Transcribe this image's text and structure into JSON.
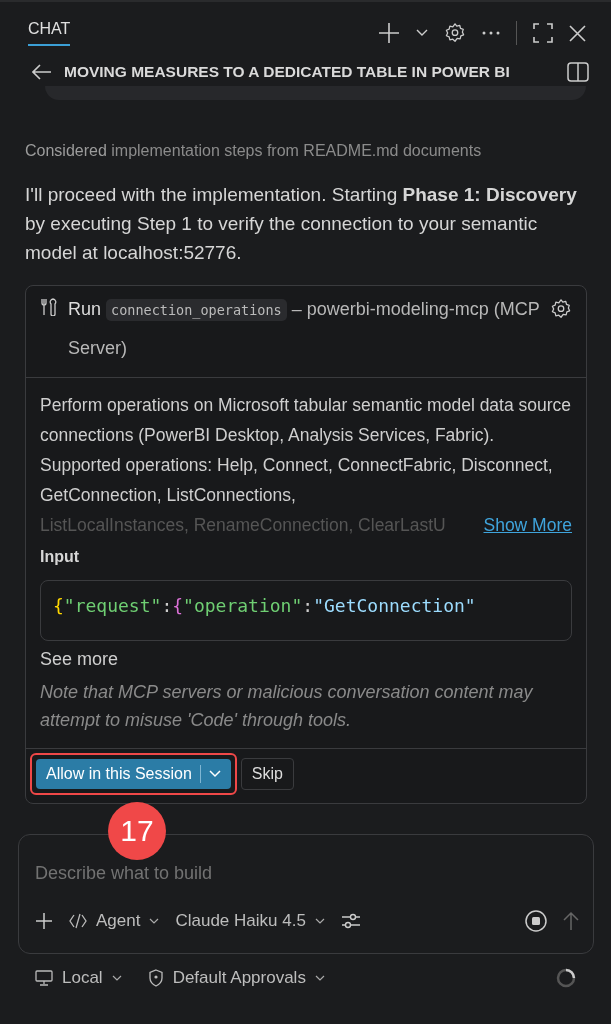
{
  "header": {
    "tab": "CHAT",
    "tab_selected": true
  },
  "title_bar": {
    "title": "MOVING MEASURES TO A DEDICATED TABLE IN POWER BI"
  },
  "thinking": {
    "verb": "Considered",
    "detail": "implementation steps from README.md documents"
  },
  "message": "I'll proceed with the implementation. Starting **Phase 1: Discovery** by executing Step 1 to verify the connection to your semantic model at localhost:52776.",
  "tool_card": {
    "run_label": "Run",
    "tool_name": "connection_operations",
    "server": "– powerbi-modeling-mcp (MCP Server)",
    "description": "Perform operations on Microsoft tabular semantic model data source connections (PowerBI Desktop, Analysis Services, Fabric). Supported operations: Help, Connect, ConnectFabric, Disconnect, GetConnection, ListConnections,",
    "description_cut": "ListLocalInstances, RenameConnection, ClearLastU",
    "show_more": "Show More",
    "input_label": "Input",
    "code": [
      {
        "kind": "brace",
        "text": "{"
      },
      {
        "kind": "key",
        "text": "\"request\""
      },
      {
        "kind": "punct",
        "text": ":"
      },
      {
        "kind": "brace2",
        "text": "{"
      },
      {
        "kind": "key",
        "text": "\"operation\""
      },
      {
        "kind": "punct",
        "text": ":"
      },
      {
        "kind": "string",
        "text": "\"GetConnection\""
      }
    ],
    "see_more": "See more",
    "note": "Note that MCP servers or malicious conversation content may attempt to misuse 'Code' through tools.",
    "allow_button": "Allow in this Session",
    "skip_button": "Skip",
    "highlighted": true
  },
  "annotation": {
    "step": "17"
  },
  "composer": {
    "placeholder": "Describe what to build",
    "mode": "Agent",
    "model": "Claude Haiku 4.5"
  },
  "footer": {
    "location": "Local",
    "approvals": "Default Approvals"
  }
}
